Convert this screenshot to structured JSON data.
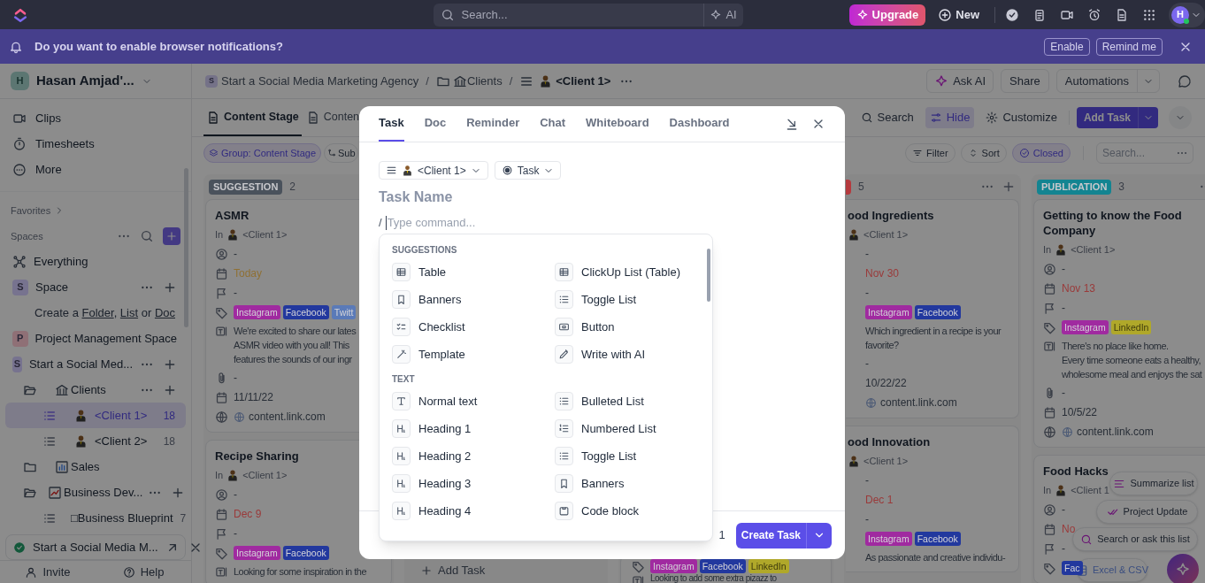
{
  "top_bar": {
    "search_placeholder": "Search...",
    "ai_label": "AI",
    "upgrade_label": "Upgrade",
    "new_label": "New",
    "avatar_initial": "H"
  },
  "notification": {
    "message": "Do you want to enable browser notifications?",
    "buttons": [
      "Enable",
      "Remind me"
    ]
  },
  "sidebar": {
    "workspace": {
      "initial": "H",
      "name": "Hasan Amjad'..."
    },
    "nav": [
      "Clips",
      "Timesheets",
      "More"
    ],
    "favorites_label": "Favorites",
    "spaces_label": "Spaces",
    "tree": [
      {
        "kind": "everything",
        "label": "Everything"
      },
      {
        "kind": "space",
        "badge": "S",
        "color": "#77738f",
        "label": "Space",
        "actions": true,
        "children": [
          {
            "kind": "create",
            "parts": [
              {
                "text": "Create a "
              },
              {
                "link": "Folder"
              },
              {
                "text": ", "
              },
              {
                "link": "List"
              },
              {
                "text": " or "
              },
              {
                "link": "Doc"
              }
            ]
          }
        ]
      },
      {
        "kind": "space",
        "badge": "P",
        "color": "#8f7076",
        "label": "Project Management Space",
        "actions": false
      },
      {
        "kind": "space",
        "badge": "S",
        "color": "#77738f",
        "label": "Start a Social Med...",
        "actions": true,
        "children": [
          {
            "kind": "folder",
            "label": "Clients",
            "expanded": true,
            "actions": true,
            "children": [
              {
                "kind": "list",
                "label": "<Client 1>",
                "count": "18",
                "avatar": true,
                "selected": true
              },
              {
                "kind": "list",
                "label": "<Client 2>",
                "count": "18",
                "avatar": true,
                "selected": false
              }
            ]
          },
          {
            "kind": "folder",
            "label": "Sales",
            "expanded": false,
            "actions": false
          },
          {
            "kind": "folder",
            "label": "Business Dev...",
            "expanded": true,
            "actions": true,
            "children": [
              {
                "kind": "list",
                "label": "□Business Blueprint",
                "count": "7",
                "avatar": false,
                "selected": false
              }
            ]
          }
        ]
      }
    ],
    "recent": "Start a Social Media M...",
    "footer": [
      "Invite",
      "Help"
    ]
  },
  "header": {
    "breadcrumb": [
      {
        "badge": "S",
        "label": "Start a Social Media Marketing Agency"
      },
      {
        "label": "Clients"
      },
      {
        "label": "<Client 1>"
      }
    ],
    "separator": "/",
    "buttons": [
      "Ask AI",
      "Share",
      "Automations"
    ]
  },
  "view_tabs": [
    {
      "label": "Content Stage",
      "selected": true
    },
    {
      "label": "Conten",
      "selected": false
    }
  ],
  "toolbar": [
    {
      "kind": "search",
      "label": "Search",
      "active": false
    },
    {
      "kind": "hide",
      "label": "Hide",
      "active": true
    },
    {
      "kind": "customize",
      "label": "Customize",
      "active": false
    }
  ],
  "add_task_label": "Add Task",
  "chips": [
    "Group: Content Stage",
    "Sub"
  ],
  "filters": [
    {
      "kind": "filter",
      "label": "Filter",
      "active": false
    },
    {
      "kind": "sort",
      "label": "Sort",
      "active": false
    },
    {
      "kind": "closed",
      "label": "Closed",
      "active": true
    }
  ],
  "board_search_placeholder": "Search...",
  "board": [
    {
      "kind": "full",
      "status": "SUGGESTION",
      "color": "#4a525c",
      "count": "2",
      "menu": false,
      "add": false,
      "cards": [
        {
          "title": "ASMR",
          "fields": [
            {
              "kind": "list",
              "label": "In",
              "text": "<Client 1>"
            },
            {
              "kind": "assignee",
              "text": "-"
            },
            {
              "kind": "due",
              "text": "Today",
              "color": "#8f7034"
            },
            {
              "kind": "priority",
              "text": "-"
            },
            {
              "kind": "tags",
              "tags": [
                {
                  "label": "Instagram",
                  "color": "#a02aa0"
                },
                {
                  "label": "Facebook",
                  "color": "#22389e"
                },
                {
                  "label": "Twitt",
                  "color": "#5a7ab8"
                }
              ]
            },
            {
              "kind": "description",
              "lines": [
                "We're excited to share our lates",
                "ASMR video with you all! This",
                "features the sounds of our ingr"
              ]
            },
            {
              "kind": "attachment",
              "text": "-"
            },
            {
              "kind": "date",
              "text": "11/11/22"
            },
            {
              "kind": "link",
              "text": "content.link.com"
            }
          ]
        },
        {
          "title": "Recipe Sharing",
          "fields": [
            {
              "kind": "list",
              "label": "In",
              "text": "<Client 1>"
            },
            {
              "kind": "assignee",
              "text": "-"
            },
            {
              "kind": "due",
              "text": "Dec 9",
              "color": "#9a3a3a"
            },
            {
              "kind": "priority",
              "text": "-"
            },
            {
              "kind": "tags",
              "tags": [
                {
                  "label": "Instagram",
                  "color": "#a02aa0"
                },
                {
                  "label": "Facebook",
                  "color": "#22389e"
                }
              ]
            },
            {
              "kind": "description",
              "lines": [
                "Looking for some inspiration in the"
              ]
            }
          ]
        }
      ]
    },
    {
      "kind": "covered",
      "add_task": "Add Task"
    },
    {
      "kind": "covered",
      "cards": [
        {
          "fields": [
            {
              "kind": "tags",
              "tags": [
                {
                  "label": "Instagram",
                  "color": "#a02aa0"
                },
                {
                  "label": "Facebook",
                  "color": "#22389e"
                },
                {
                  "label": "LinkedIn",
                  "color": "#b0a82a"
                }
              ]
            },
            {
              "kind": "description",
              "lines": [
                "Looking to add some extra pizazz to"
              ]
            }
          ]
        }
      ]
    },
    {
      "kind": "partial",
      "color": "#b53a3e",
      "count": "5",
      "menu": true,
      "add": true,
      "cards": [
        {
          "title": "ood Ingredients",
          "fields": [
            {
              "kind": "list",
              "text": "<Client 1>"
            },
            {
              "kind": "assignee",
              "text": "-"
            },
            {
              "kind": "due",
              "text": "Nov 30",
              "color": "#9a3a3a"
            },
            {
              "kind": "priority",
              "text": "-"
            },
            {
              "kind": "tags",
              "tags": [
                {
                  "label": "Instagram",
                  "color": "#a02aa0"
                },
                {
                  "label": "Facebook",
                  "color": "#22389e"
                }
              ]
            },
            {
              "kind": "description",
              "lines": [
                "Which ingredient in a recipe is your",
                "favorite?"
              ]
            },
            {
              "kind": "attachment",
              "text": "-"
            },
            {
              "kind": "date",
              "text": "10/22/22"
            },
            {
              "kind": "link",
              "text": "content.link.com"
            }
          ]
        },
        {
          "title": "ood Innovation",
          "fields": [
            {
              "kind": "list",
              "text": "<Client 1>"
            },
            {
              "kind": "assignee",
              "text": "-"
            },
            {
              "kind": "due",
              "text": "Dec 1",
              "color": "#9a3a3a"
            },
            {
              "kind": "priority",
              "text": "-"
            },
            {
              "kind": "tags",
              "tags": [
                {
                  "label": "Instagram",
                  "color": "#a02aa0"
                },
                {
                  "label": "Facebook",
                  "color": "#22389e"
                }
              ]
            },
            {
              "kind": "description",
              "lines": [
                "As passionate and creative individu-"
              ]
            }
          ]
        }
      ]
    },
    {
      "kind": "full",
      "status": "PUBLICATION",
      "color": "#138491",
      "count": "3",
      "menu": true,
      "add": false,
      "cards": [
        {
          "title": "Getting to know the Food Company",
          "fields": [
            {
              "kind": "list",
              "label": "In",
              "text": "<Client 1>"
            },
            {
              "kind": "assignee",
              "text": "-"
            },
            {
              "kind": "due",
              "text": "Nov 13",
              "color": "#9a3a3a"
            },
            {
              "kind": "priority",
              "text": "-"
            },
            {
              "kind": "tags",
              "tags": [
                {
                  "label": "Instagram",
                  "color": "#a02aa0"
                },
                {
                  "label": "LinkedIn",
                  "color": "#b0a82a"
                }
              ]
            },
            {
              "kind": "description",
              "lines": [
                "There's no place like home.",
                "Every time someone eats a healthy,",
                "wholesome meal and enjoys the sat"
              ]
            },
            {
              "kind": "attachment",
              "text": "-"
            },
            {
              "kind": "date",
              "text": "10/5/22"
            },
            {
              "kind": "link",
              "text": "content.link.com"
            }
          ]
        },
        {
          "title": "Food Hacks",
          "fields": [
            {
              "kind": "list",
              "label": "In",
              "text": "<Client 1"
            },
            {
              "kind": "assignee",
              "text": "-"
            },
            {
              "kind": "due",
              "text": "No",
              "color": "#9a3a3a"
            },
            {
              "kind": "priority",
              "text": "-"
            },
            {
              "kind": "tags",
              "tags": [
                {
                  "label": "Fac",
                  "color": "#22389e"
                }
              ]
            }
          ]
        }
      ]
    }
  ],
  "ai_actions": [
    "Summarize list",
    "Project Update",
    "Search or ask this list",
    "Excel & CSV"
  ],
  "modal": {
    "tabs": [
      {
        "label": "Task",
        "selected": true
      },
      {
        "label": "Doc",
        "selected": false
      },
      {
        "label": "Reminder",
        "selected": false
      },
      {
        "label": "Chat",
        "selected": false
      },
      {
        "label": "Whiteboard",
        "selected": false
      },
      {
        "label": "Dashboard",
        "selected": false
      }
    ],
    "location": "<Client 1>",
    "type": "Task",
    "title_placeholder": "Task Name",
    "command_prefix": "/",
    "command_placeholder": "Type command...",
    "menu": [
      {
        "heading": "SUGGESTIONS",
        "items": [
          "Table",
          "ClickUp List (Table)",
          "Banners",
          "Toggle List",
          "Checklist",
          "Button",
          "Template",
          "Write with AI"
        ]
      },
      {
        "heading": "TEXT",
        "items": [
          "Normal text",
          "Bulleted List",
          "Heading 1",
          "Numbered List",
          "Heading 2",
          "Toggle List",
          "Heading 3",
          "Banners",
          "Heading 4",
          "Code block"
        ]
      }
    ],
    "footer_count": "1",
    "submit": "Create Task"
  }
}
